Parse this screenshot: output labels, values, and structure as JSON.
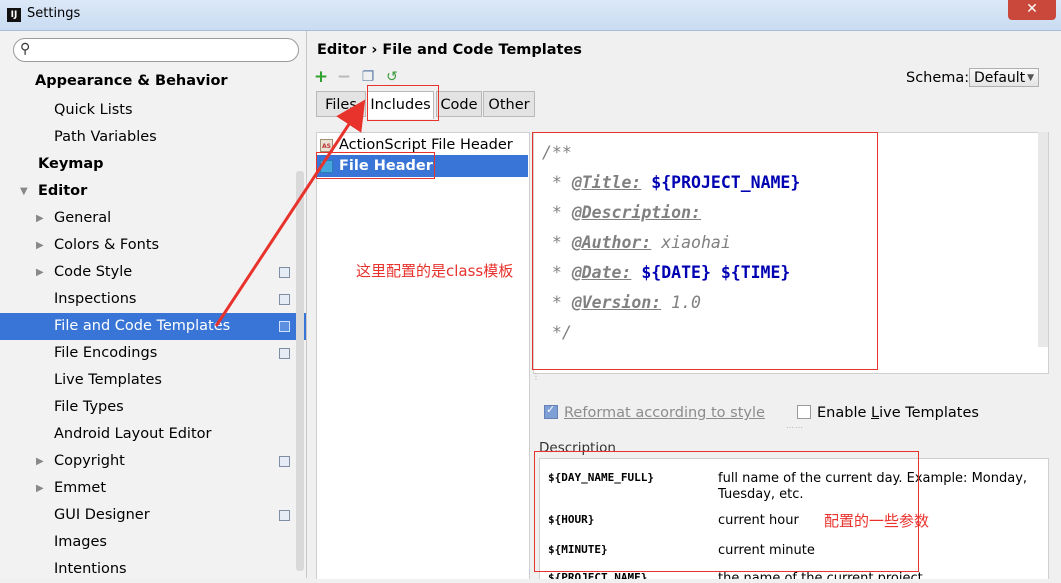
{
  "window": {
    "title": "Settings",
    "close_glyph": "✕"
  },
  "sidebar": {
    "search_placeholder": "",
    "items": [
      {
        "label": "Appearance & Behavior",
        "bold": true
      },
      {
        "label": "Quick Lists"
      },
      {
        "label": "Path Variables"
      },
      {
        "label": "Keymap",
        "bold": true
      },
      {
        "label": "Editor",
        "bold": true
      },
      {
        "label": "General"
      },
      {
        "label": "Colors & Fonts"
      },
      {
        "label": "Code Style"
      },
      {
        "label": "Inspections"
      },
      {
        "label": "File and Code Templates",
        "selected": true
      },
      {
        "label": "File Encodings"
      },
      {
        "label": "Live Templates"
      },
      {
        "label": "File Types"
      },
      {
        "label": "Android Layout Editor"
      },
      {
        "label": "Copyright"
      },
      {
        "label": "Emmet"
      },
      {
        "label": "GUI Designer"
      },
      {
        "label": "Images"
      },
      {
        "label": "Intentions"
      }
    ]
  },
  "header": {
    "breadcrumb": "Editor › File and Code Templates",
    "schema_label": "Schema:",
    "schema_value": "Default"
  },
  "tabs": [
    "Files",
    "Includes",
    "Code",
    "Other"
  ],
  "templates": [
    {
      "label": "ActionScript File Header",
      "icon": "actionscript-icon"
    },
    {
      "label": "File Header",
      "icon": "java-file-icon",
      "selected": true
    }
  ],
  "editor": {
    "lines": [
      {
        "pre": "/**",
        "tag": "",
        "rest": ""
      },
      {
        "pre": " * ",
        "tag": "@Title:",
        "rest": " ${PROJECT_NAME}"
      },
      {
        "pre": " * ",
        "tag": "@Description:",
        "rest": ""
      },
      {
        "pre": " * ",
        "tag": "@Author:",
        "rest": " xiaohai"
      },
      {
        "pre": " * ",
        "tag": "@Date:",
        "rest": " ${DATE} ${TIME}"
      },
      {
        "pre": " * ",
        "tag": "@Version:",
        "rest": " 1.0"
      },
      {
        "pre": " */",
        "tag": "",
        "rest": ""
      }
    ]
  },
  "options": {
    "reformat": "Reformat according to style",
    "live_prefix": "Enable ",
    "live_underlined": "L",
    "live_suffix": "ive Templates"
  },
  "description": {
    "label": "Description",
    "rows": [
      {
        "key": "${DAY_NAME_FULL}",
        "value": "full name of the current day. Example: Monday, Tuesday, etc."
      },
      {
        "key": "${HOUR}",
        "value": "current hour"
      },
      {
        "key": "${MINUTE}",
        "value": "current minute"
      },
      {
        "key": "${PROJECT_NAME}",
        "value": "the name of the current project"
      }
    ]
  },
  "annotations": {
    "class_template": "这里配置的是class模板",
    "params": "配置的一些参数",
    "color": "#e8322c"
  }
}
